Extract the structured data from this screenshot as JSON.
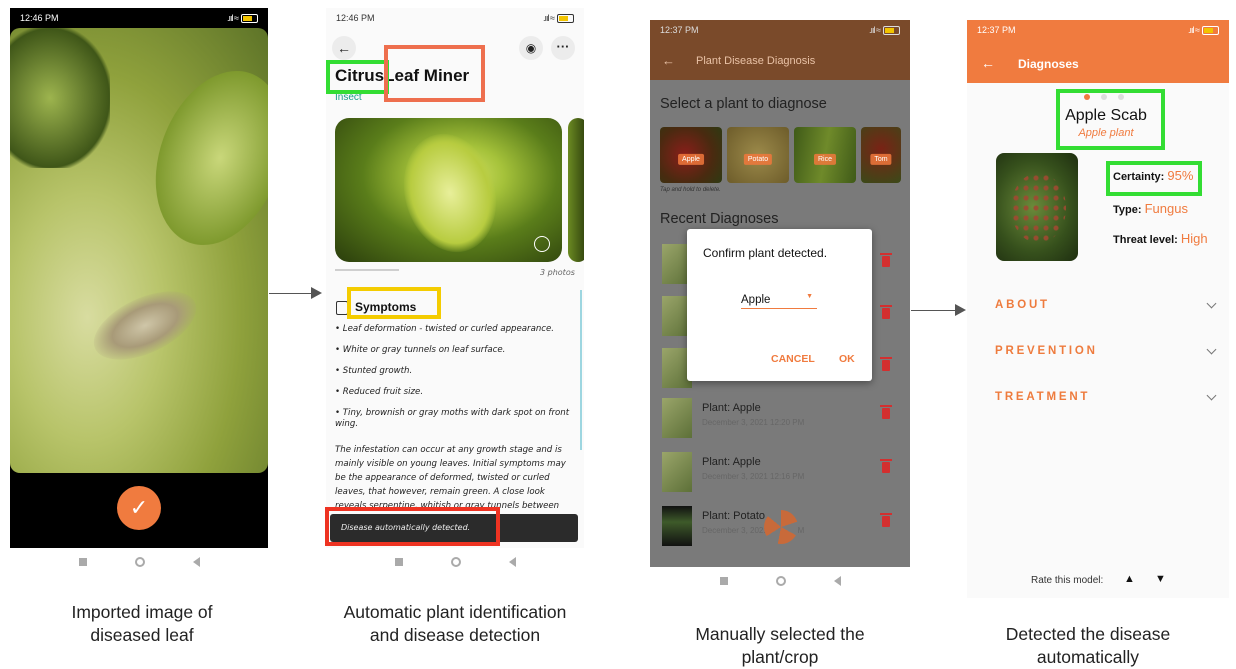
{
  "captions": [
    "Imported image of diseased leaf",
    "Automatic plant identification and disease detection",
    "Manually selected the plant/crop",
    "Detected the disease automatically"
  ],
  "phone1": {
    "status_time": "12:46 PM",
    "close_icon": "close-icon",
    "confirm_icon": "check-icon"
  },
  "phone2": {
    "status_time": "12:46 PM",
    "title_part1": "Citrus",
    "title_part2": "Leaf Miner",
    "category": "Insect",
    "photos_count": "3 photos",
    "section_title": "Symptoms",
    "symptoms": [
      "• Leaf deformation - twisted or curled appearance.",
      "• White or gray tunnels on leaf surface.",
      "• Stunted growth.",
      "• Reduced fruit size.",
      "• Tiny, brownish or gray moths with dark spot on front wing."
    ],
    "paragraph": "The infestation can occur at any growth stage and is mainly visible on young leaves. Initial symptoms may be the appearance of deformed, twisted or curled leaves, that however, remain green. A close look reveals serpentine, whitish or gray tunnels between the two",
    "toast": "Disease automatically detected."
  },
  "phone3": {
    "status_time": "12:37 PM",
    "app_title": "Plant Disease Diagnosis",
    "select_heading": "Select a plant to diagnose",
    "plants": [
      "Apple",
      "Potato",
      "Rice",
      "Tom"
    ],
    "hint": "Tap and hold to delete.",
    "recent_heading": "Recent Diagnoses",
    "dialog_title": "Confirm plant detected.",
    "dialog_value": "Apple",
    "cancel": "CANCEL",
    "ok": "OK",
    "recent": [
      {
        "title": "Plant: Apple",
        "date": "December 3, 2021 12:20 PM"
      },
      {
        "title": "Plant: Apple",
        "date": "December 3, 2021 12:16 PM"
      },
      {
        "title": "Plant: Potato",
        "date": "December 3, 2021 12:14 PM"
      }
    ]
  },
  "phone4": {
    "status_time": "12:37 PM",
    "app_title": "Diagnoses",
    "disease": "Apple Scab",
    "plant": "Apple plant",
    "certainty_label": "Certainty:",
    "certainty_value": "95%",
    "type_label": "Type:",
    "type_value": "Fungus",
    "threat_label": "Threat level:",
    "threat_value": "High",
    "sections": [
      "ABOUT",
      "PREVENTION",
      "TREATMENT"
    ],
    "rate_label": "Rate this model:"
  },
  "colors": {
    "accent": "#f07b3f",
    "highlight_green": "#33dd33",
    "highlight_orange": "#ee6f4e",
    "highlight_yellow": "#f4cc00",
    "highlight_red": "#ee3322"
  }
}
